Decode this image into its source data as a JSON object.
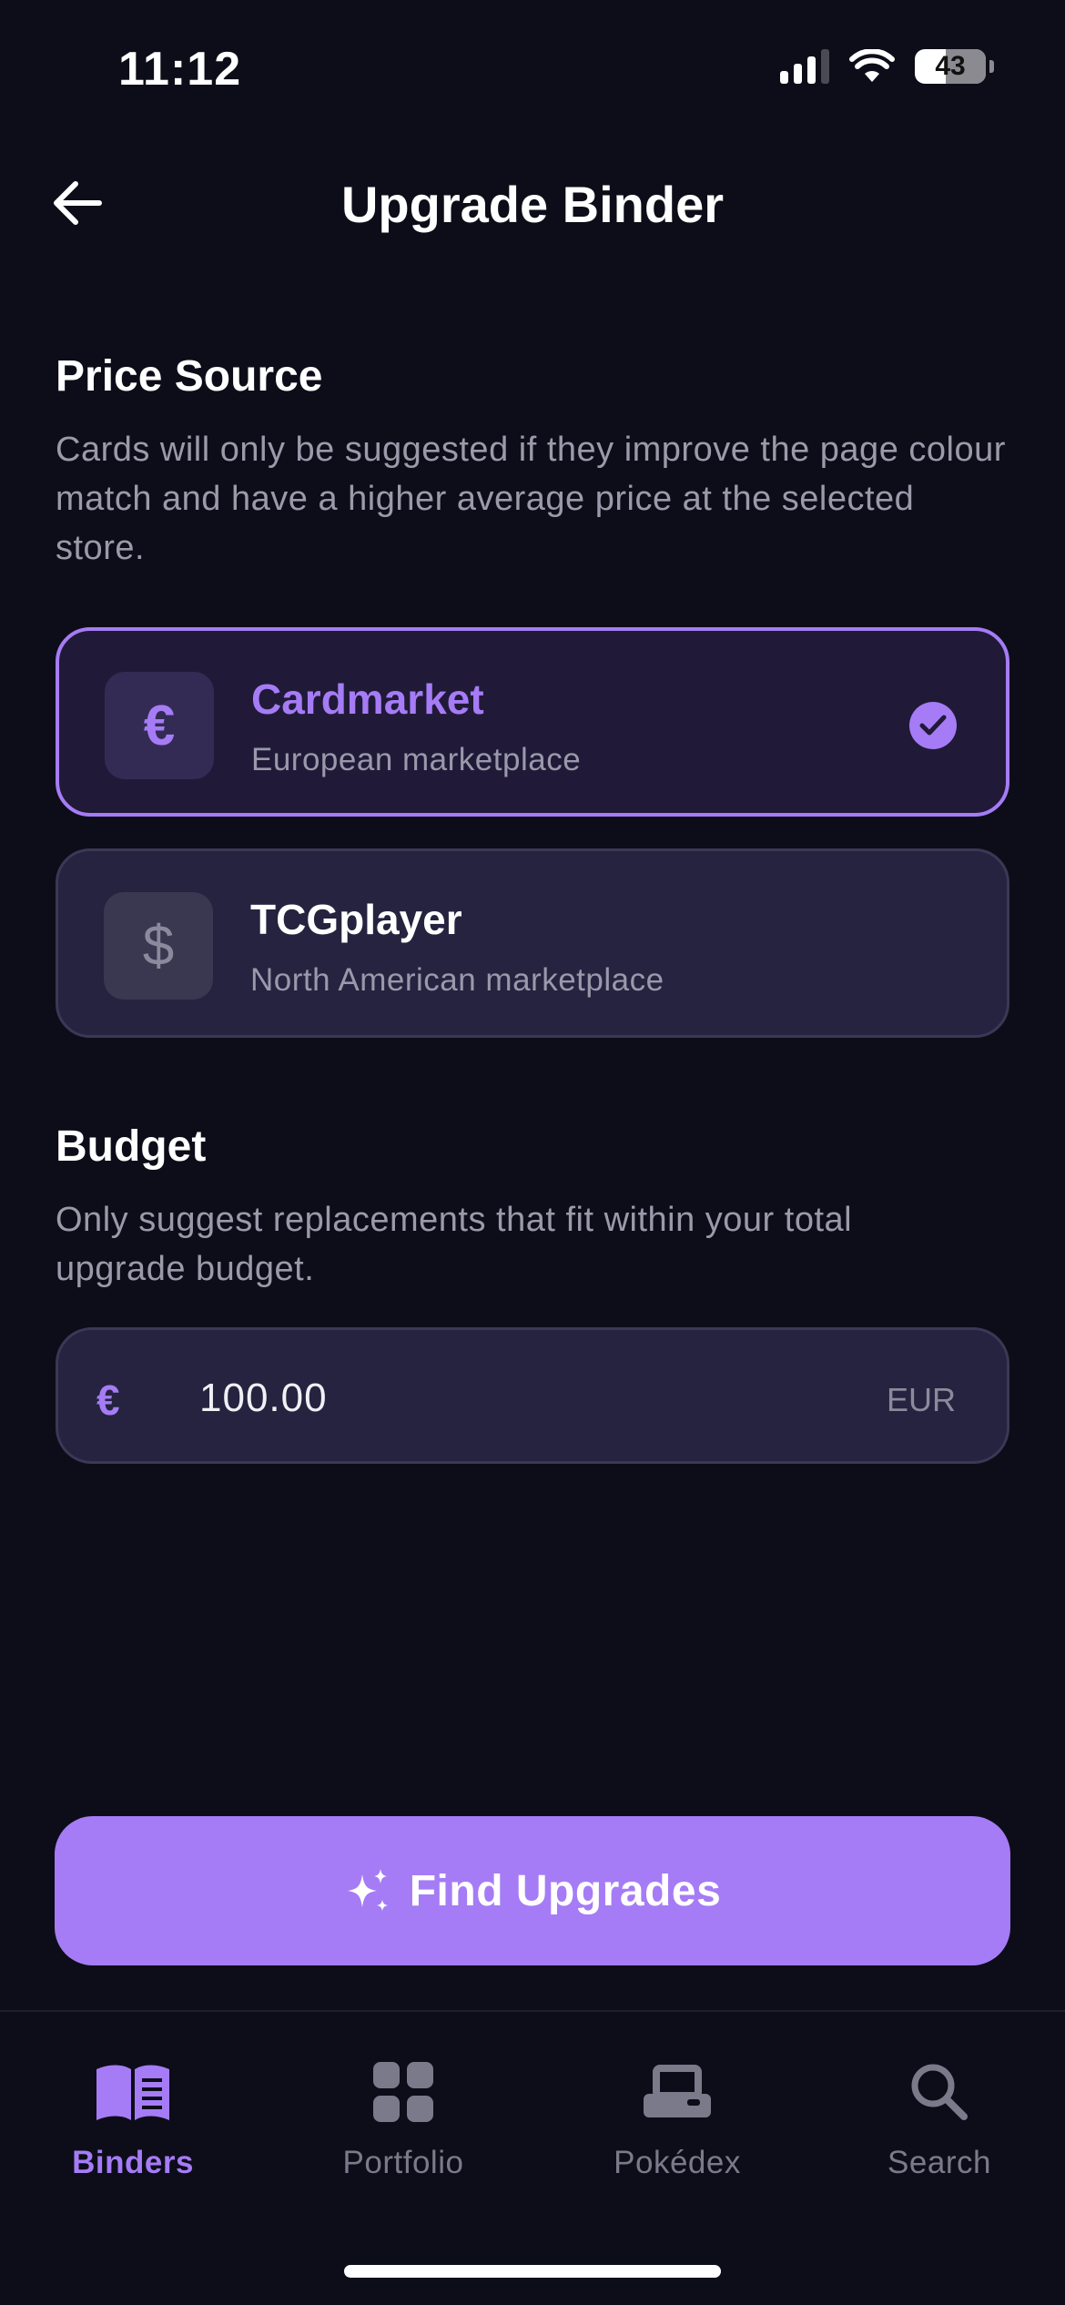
{
  "status_bar": {
    "time": "11:12",
    "battery": "43"
  },
  "header": {
    "title": "Upgrade Binder"
  },
  "price_source": {
    "title": "Price Source",
    "description": "Cards will only be suggested if they improve the page colour match and have a higher average price at the selected store.",
    "options": [
      {
        "icon": "€",
        "name": "Cardmarket",
        "subtitle": "European marketplace",
        "selected": true
      },
      {
        "icon": "$",
        "name": "TCGplayer",
        "subtitle": "North American marketplace",
        "selected": false
      }
    ]
  },
  "budget": {
    "title": "Budget",
    "description": "Only suggest replacements that fit within your total upgrade budget.",
    "currency_symbol": "€",
    "value": "100.00",
    "currency_code": "EUR"
  },
  "cta": {
    "label": "Find Upgrades"
  },
  "tabs": [
    {
      "label": "Binders",
      "icon": "book-icon",
      "active": true
    },
    {
      "label": "Portfolio",
      "icon": "grid-icon",
      "active": false
    },
    {
      "label": "Pokédex",
      "icon": "pokedex-icon",
      "active": false
    },
    {
      "label": "Search",
      "icon": "search-icon",
      "active": false
    }
  ],
  "colors": {
    "accent": "#a57cf5",
    "background": "#0d0d19",
    "card": "#25233f"
  }
}
